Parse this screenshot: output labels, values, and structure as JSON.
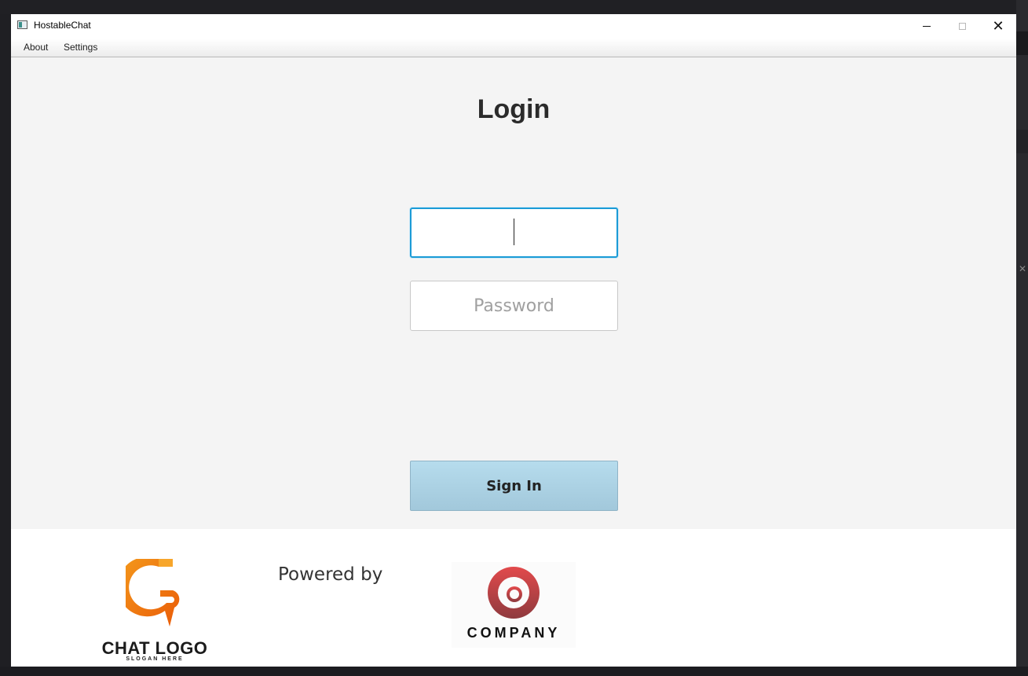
{
  "window": {
    "title": "HostableChat"
  },
  "menu": {
    "items": [
      "About",
      "Settings"
    ]
  },
  "login": {
    "heading": "Login",
    "username": {
      "value": "",
      "placeholder": ""
    },
    "password": {
      "value": "",
      "placeholder": "Password"
    },
    "sign_in_label": "Sign In"
  },
  "footer": {
    "chat_logo_text": "CHAT LOGO",
    "chat_logo_slogan": "SLOGAN HERE",
    "powered_by": "Powered by",
    "company_text": "COMPANY"
  },
  "colors": {
    "accent": "#1b9bd6",
    "button": "#a9d0e2",
    "chat_logo": "#f07a10",
    "company_logo": "#b03a3c"
  },
  "icons": [
    "app-icon",
    "minimize-icon",
    "maximize-icon",
    "close-icon",
    "chat-logo-icon",
    "company-logo-icon"
  ]
}
